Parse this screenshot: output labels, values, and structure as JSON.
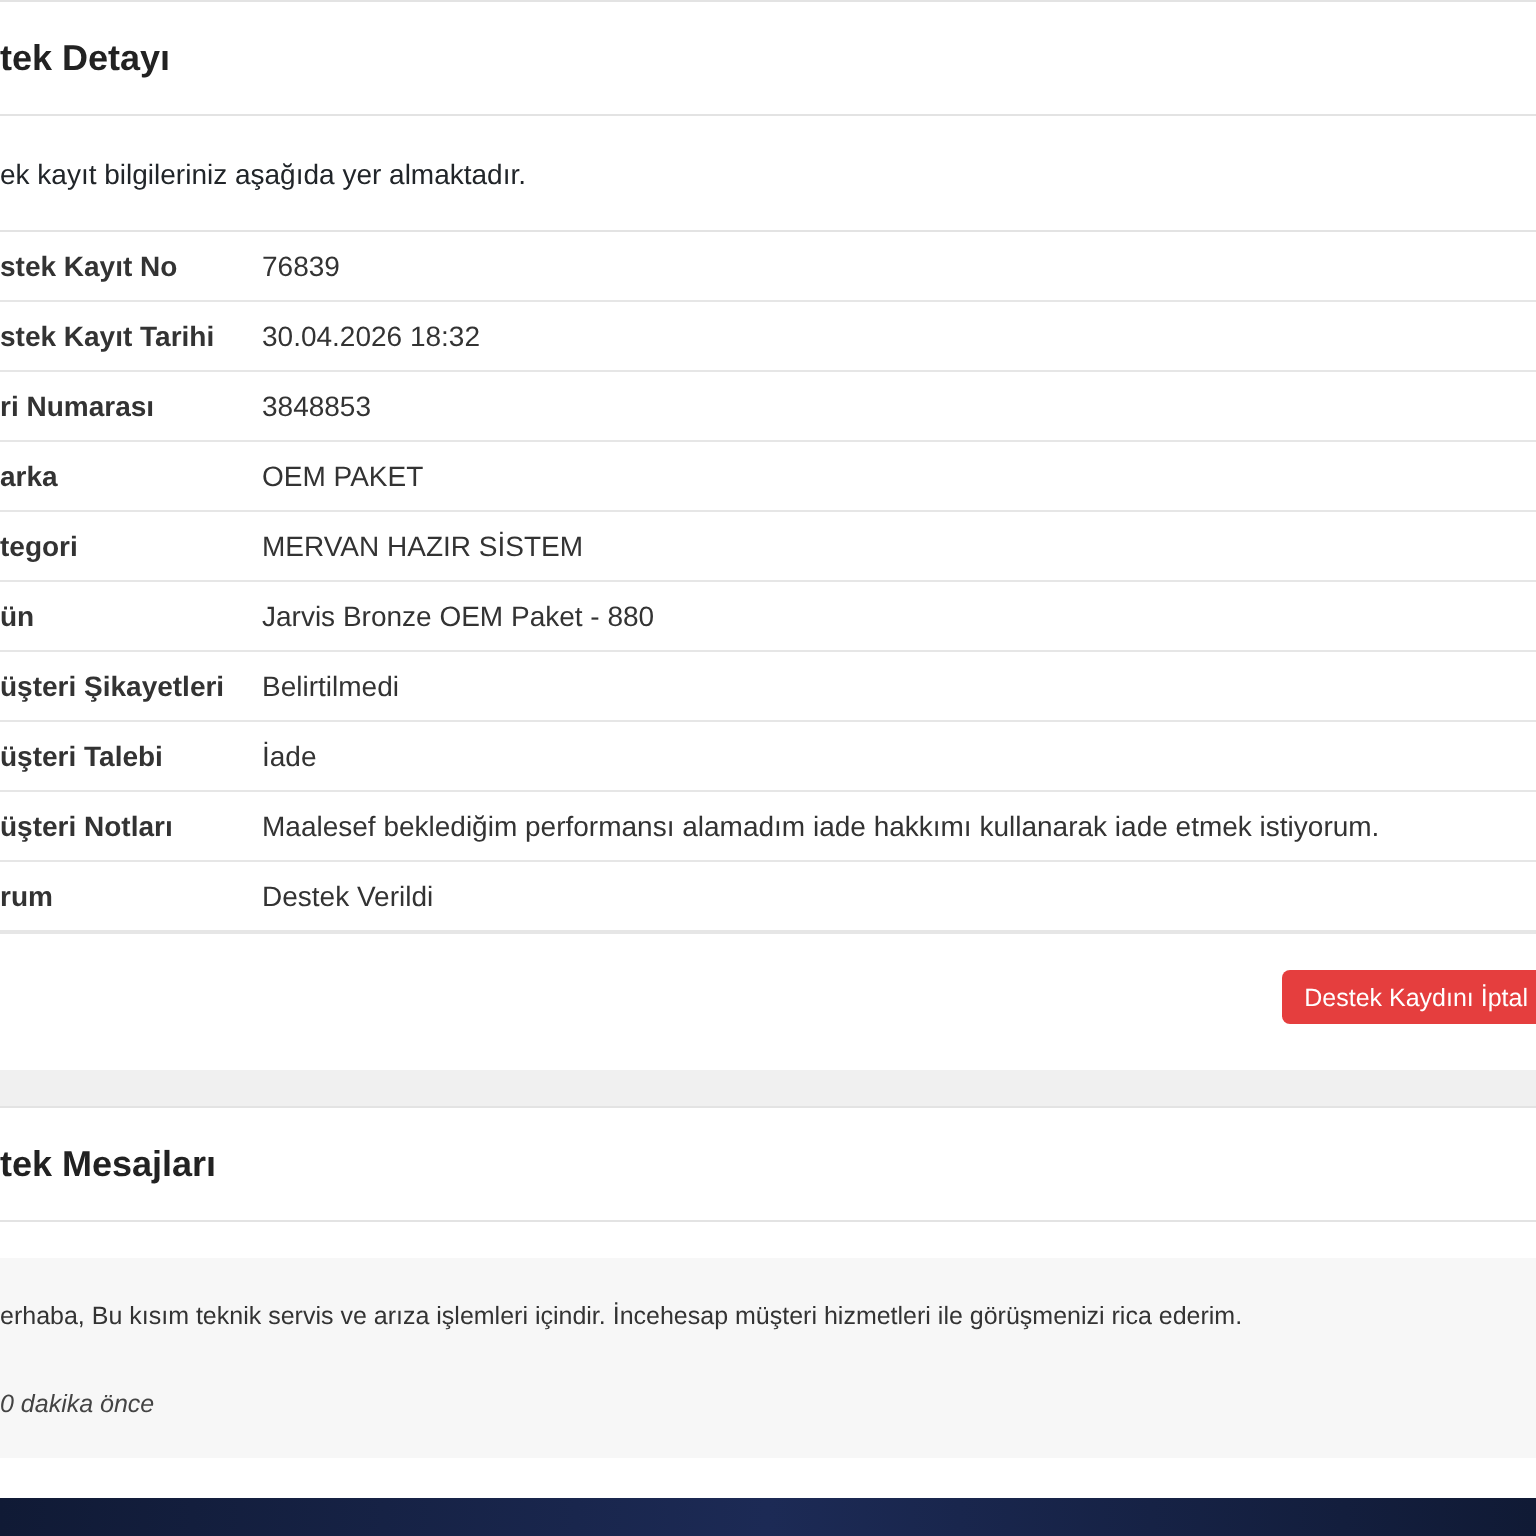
{
  "detail_card": {
    "title": "tek Detayı",
    "subtitle": "ek kayıt bilgileriniz aşağıda yer almaktadır.",
    "rows": [
      {
        "label": "stek Kayıt No",
        "value": "76839"
      },
      {
        "label": "stek Kayıt Tarihi",
        "value": "30.04.2026 18:32"
      },
      {
        "label": "ri Numarası",
        "value": "3848853"
      },
      {
        "label": "arka",
        "value": "OEM PAKET"
      },
      {
        "label": "tegori",
        "value": "MERVAN HAZIR SİSTEM"
      },
      {
        "label": "ün",
        "value": "Jarvis Bronze OEM Paket - 880"
      },
      {
        "label": "üşteri Şikayetleri",
        "value": "Belirtilmedi"
      },
      {
        "label": "üşteri Talebi",
        "value": "İade"
      },
      {
        "label": "üşteri Notları",
        "value": "Maalesef beklediğim performansı alamadım iade hakkımı kullanarak iade etmek istiyorum."
      },
      {
        "label": "rum",
        "value": "Destek Verildi"
      }
    ],
    "cancel_button": "Destek Kaydını İptal"
  },
  "messages_card": {
    "title": "tek Mesajları",
    "messages": [
      {
        "text": "erhaba, Bu kısım teknik servis ve arıza işlemleri içindir. İncehesap müşteri hizmetleri ile görüşmenizi rica ederim.",
        "time": "0 dakika önce"
      }
    ]
  }
}
